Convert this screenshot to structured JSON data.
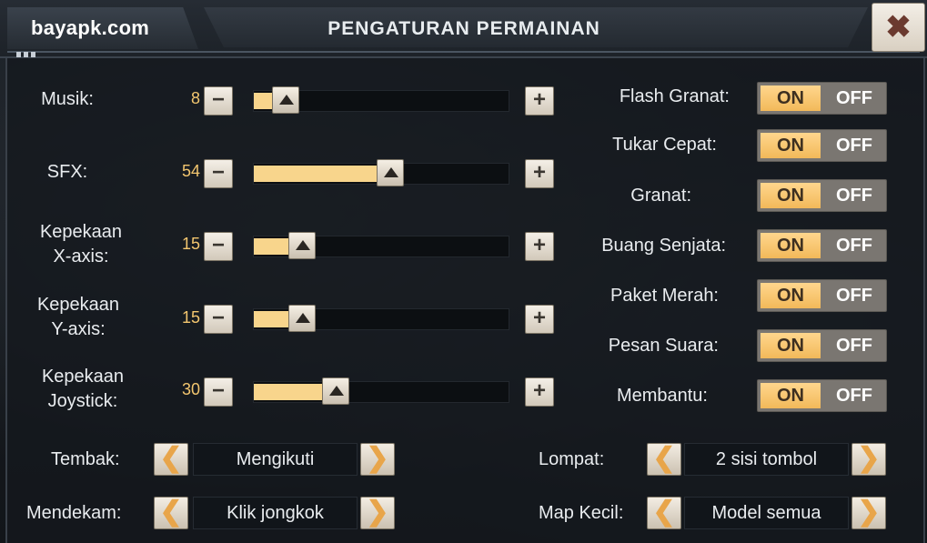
{
  "header": {
    "brand": "bayapk.com",
    "title": "PENGATURAN PERMAINAN",
    "close_label": "✖"
  },
  "sliders": [
    {
      "label_lines": [
        "Musik:"
      ],
      "value": "8",
      "level": 8,
      "minus": "−",
      "plus": "+"
    },
    {
      "label_lines": [
        "SFX:"
      ],
      "value": "54",
      "level": 54,
      "minus": "−",
      "plus": "+"
    },
    {
      "label_lines": [
        "Kepekaan",
        "X-axis:"
      ],
      "value": "15",
      "level": 15,
      "minus": "−",
      "plus": "+"
    },
    {
      "label_lines": [
        "Kepekaan",
        "Y-axis:"
      ],
      "value": "15",
      "level": 15,
      "minus": "−",
      "plus": "+"
    },
    {
      "label_lines": [
        "Kepekaan",
        "Joystick:"
      ],
      "value": "30",
      "level": 30,
      "minus": "−",
      "plus": "+"
    }
  ],
  "toggles": [
    {
      "label": "Flash Granat:",
      "on": "ON",
      "off": "OFF",
      "state": "on"
    },
    {
      "label": "Tukar Cepat:",
      "on": "ON",
      "off": "OFF",
      "state": "on"
    },
    {
      "label": "Granat:",
      "on": "ON",
      "off": "OFF",
      "state": "on"
    },
    {
      "label": "Buang Senjata:",
      "on": "ON",
      "off": "OFF",
      "state": "on"
    },
    {
      "label": "Paket Merah:",
      "on": "ON",
      "off": "OFF",
      "state": "on"
    },
    {
      "label": "Pesan Suara:",
      "on": "ON",
      "off": "OFF",
      "state": "on"
    },
    {
      "label": "Membantu:",
      "on": "ON",
      "off": "OFF",
      "state": "on"
    }
  ],
  "selectors": {
    "tembak": {
      "label": "Tembak:",
      "value": "Mengikuti"
    },
    "mendekam": {
      "label": "Mendekam:",
      "value": "Klik jongkok"
    },
    "lompat": {
      "label": "Lompat:",
      "value": "2 sisi tombol"
    },
    "map_kecil": {
      "label": "Map Kecil:",
      "value": "Model semua"
    }
  },
  "icons": {
    "left_arrow": "chevron-left-icon",
    "right_arrow": "chevron-right-icon",
    "close": "close-icon",
    "slider_thumb": "triangle-up-icon"
  },
  "colors": {
    "accent_fill": "#f8d58c",
    "value_text": "#f3c66f",
    "arrow": "#e8a54a"
  }
}
